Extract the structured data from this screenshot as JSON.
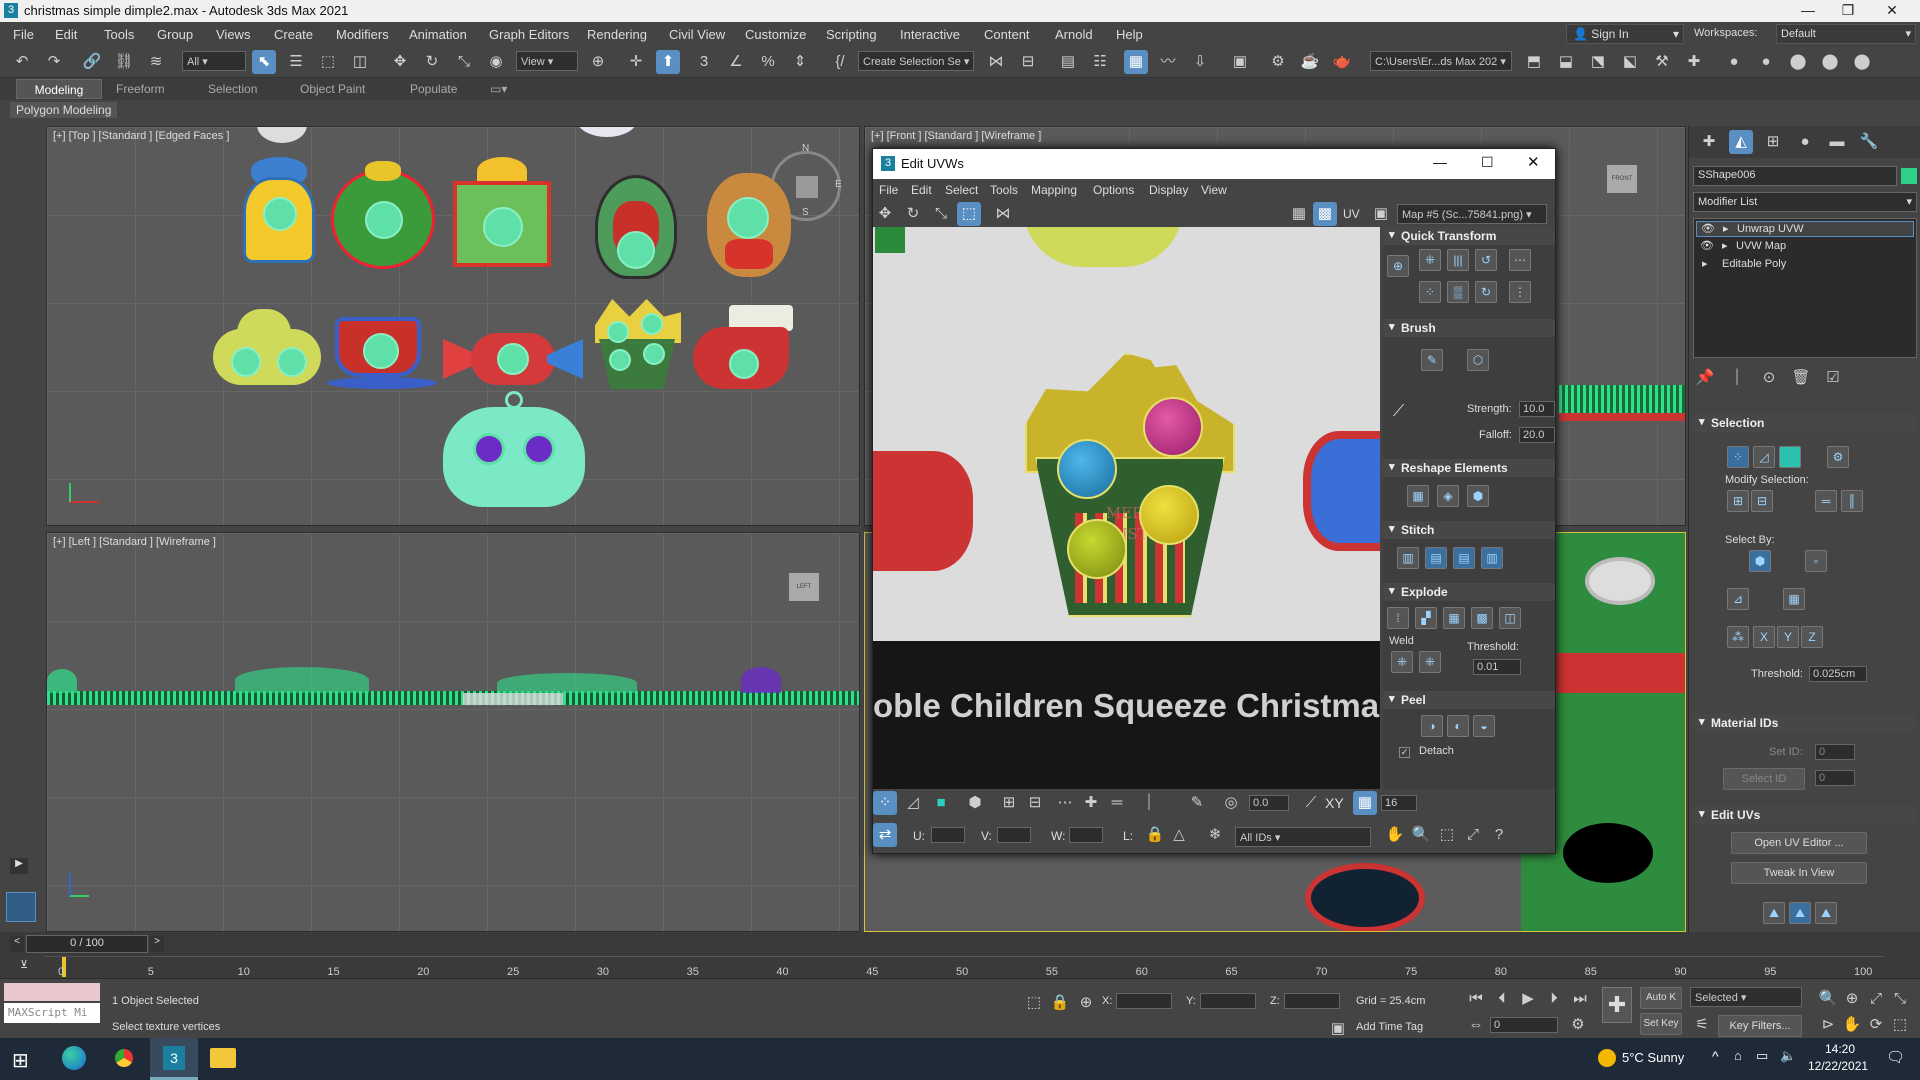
{
  "window": {
    "title": "christmas simple dimple2.max - Autodesk 3ds Max 2021"
  },
  "menu": [
    "File",
    "Edit",
    "Tools",
    "Group",
    "Views",
    "Create",
    "Modifiers",
    "Animation",
    "Graph Editors",
    "Rendering",
    "Civil View",
    "Customize",
    "Scripting",
    "Interactive",
    "Content",
    "Arnold",
    "Help"
  ],
  "signin": {
    "label": "Sign In"
  },
  "workspaces": {
    "label": "Workspaces:",
    "value": "Default"
  },
  "toolbar": {
    "filter": "All",
    "view": "View",
    "selection_set": "Create Selection Se",
    "path": "C:\\Users\\Er...ds Max 202"
  },
  "ribbon": {
    "tabs": [
      "Modeling",
      "Freeform",
      "Selection",
      "Object Paint",
      "Populate"
    ],
    "sub": "Polygon Modeling"
  },
  "viewports": {
    "top": "[+] [Top ] [Standard ] [Edged Faces ]",
    "front": "[+] [Front ] [Standard ] [Wireframe ]",
    "left": "[+] [Left ] [Standard ] [Wireframe ]",
    "viewcube_front": "FRONT",
    "viewcube_left": "LEFT",
    "compass": {
      "n": "N",
      "e": "E",
      "s": "S"
    }
  },
  "uv_editor": {
    "title": "Edit UVWs",
    "menu": [
      "File",
      "Edit",
      "Select",
      "Tools",
      "Mapping",
      "Options",
      "Display",
      "View"
    ],
    "uv_label": "UV",
    "map": "Map #5 (Sc...75841.png)",
    "banner_text": "oble Children Squeeze Christma",
    "ornament_text": "MERRY CHRISTMAS",
    "panels": {
      "quick_transform": "Quick Transform",
      "brush": "Brush",
      "strength_label": "Strength:",
      "strength": "10.0",
      "falloff_label": "Falloff:",
      "falloff": "20.0",
      "reshape": "Reshape Elements",
      "stitch": "Stitch",
      "explode": "Explode",
      "weld": "Weld",
      "threshold_label": "Threshold:",
      "threshold": "0.01",
      "peel": "Peel",
      "detach": "Detach"
    },
    "bottom": {
      "angle": "0.0",
      "xy": "XY",
      "grid_count": "16",
      "u": "U:",
      "v": "V:",
      "w": "W:",
      "l": "L:",
      "ids": "All IDs"
    }
  },
  "command_panel": {
    "object_name": "SShape006",
    "modifier_list": "Modifier List",
    "stack": [
      "Unwrap UVW",
      "UVW Map",
      "Editable Poly"
    ],
    "selection": "Selection",
    "modify_selection": "Modify Selection:",
    "select_by": "Select By:",
    "threshold_label": "Threshold:",
    "threshold": "0.025cm",
    "material_ids": "Material IDs",
    "set_id": "Set ID:",
    "select_id": "Select ID",
    "set_id_value": "0",
    "select_id_value": "0",
    "edit_uvs": "Edit UVs",
    "open_uv_editor": "Open UV Editor ...",
    "tweak_in_view": "Tweak In View"
  },
  "timeline": {
    "frame": "0 / 100",
    "ticks": [
      "0",
      "5",
      "10",
      "15",
      "20",
      "25",
      "30",
      "35",
      "40",
      "45",
      "50",
      "55",
      "60",
      "65",
      "70",
      "75",
      "80",
      "85",
      "90",
      "95",
      "100"
    ]
  },
  "status": {
    "maxscript": "MAXScript Mi",
    "objects": "1 Object Selected",
    "prompt": "Select texture vertices",
    "x": "X:",
    "y": "Y:",
    "z": "Z:",
    "grid": "Grid = 25.4cm",
    "add_time_tag": "Add Time Tag",
    "auto_key": "Auto K",
    "set_key": "Set Key",
    "selected": "Selected",
    "key_filters": "Key Filters...",
    "frame_spinner": "0"
  },
  "taskbar": {
    "weather": "5°C  Sunny",
    "time": "14:20",
    "date": "12/22/2021"
  }
}
